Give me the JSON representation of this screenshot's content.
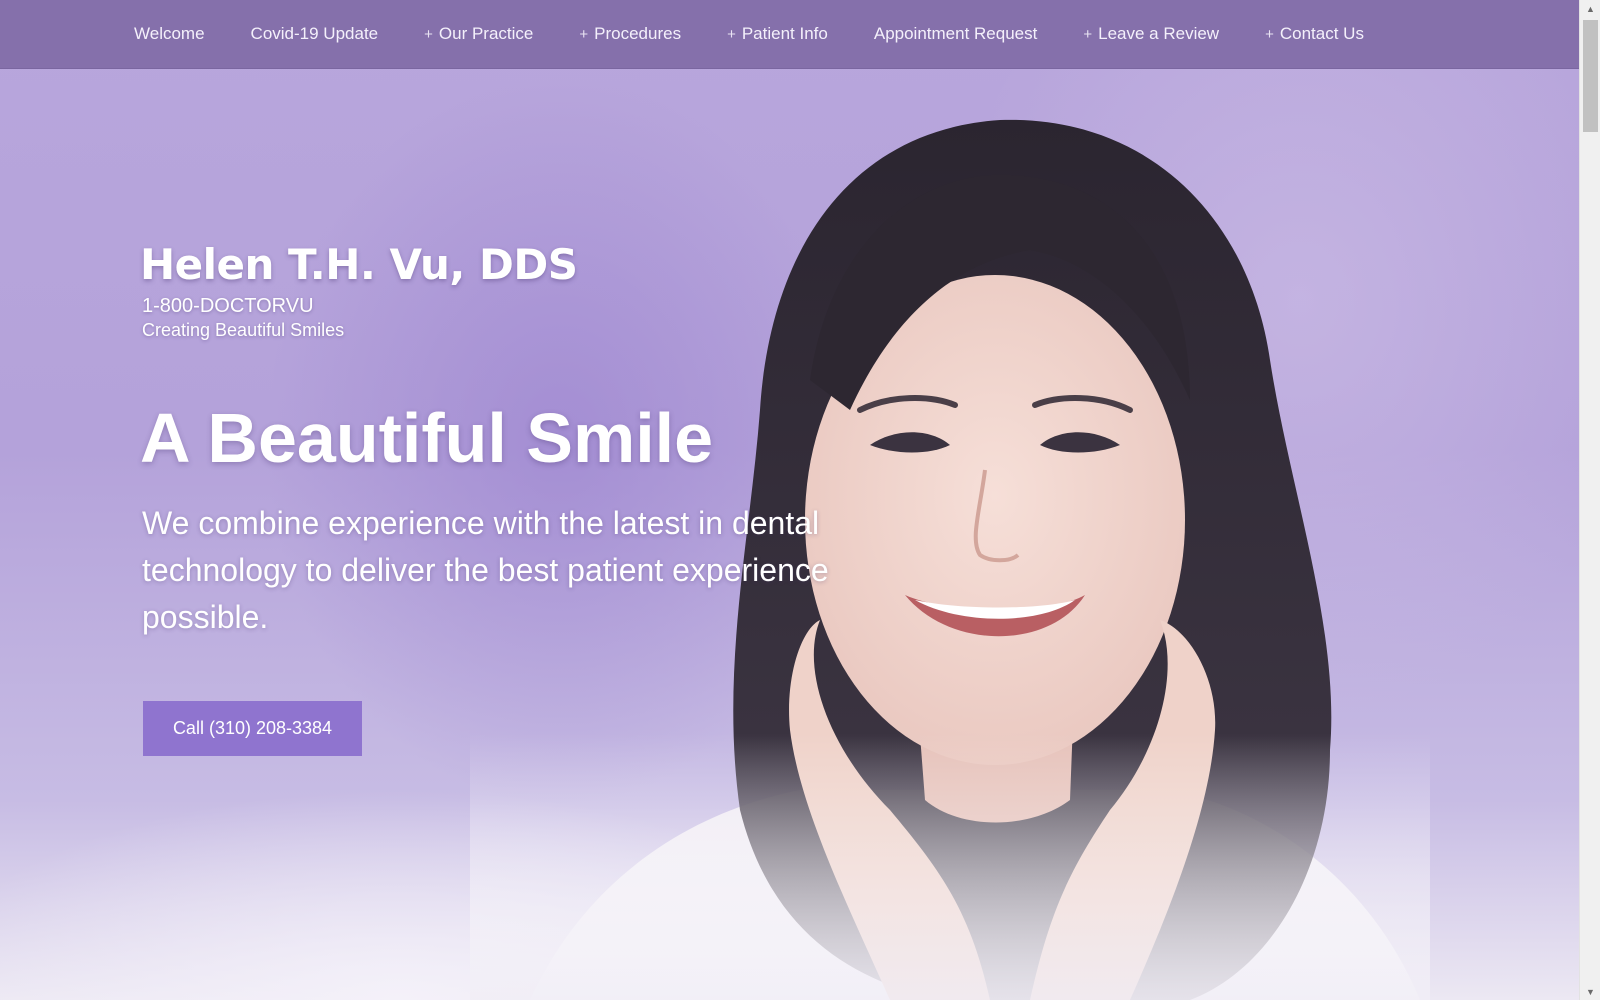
{
  "nav": {
    "items": [
      {
        "label": "Welcome",
        "has_submenu": false
      },
      {
        "label": "Covid-19 Update",
        "has_submenu": false
      },
      {
        "label": "Our Practice",
        "has_submenu": true
      },
      {
        "label": "Procedures",
        "has_submenu": true
      },
      {
        "label": "Patient Info",
        "has_submenu": true
      },
      {
        "label": "Appointment Request",
        "has_submenu": false
      },
      {
        "label": "Leave a Review",
        "has_submenu": true
      },
      {
        "label": "Contact Us",
        "has_submenu": true
      }
    ],
    "submenu_symbol": "+"
  },
  "brand": {
    "name": "Helen T.H. Vu, DDS",
    "phone": "1-800-DOCTORVU",
    "tagline": "Creating Beautiful Smiles"
  },
  "hero": {
    "title": "A Beautiful Smile",
    "text": "We combine experience with the latest in dental technology to deliver the best patient experience possible.",
    "cta_label": "Call (310) 208-3384",
    "image_icon": "smiling-woman-portrait"
  },
  "colors": {
    "nav_bg": "#8570ab",
    "hero_bg": "#b8a6dc",
    "button_bg": "#8f74cf",
    "text": "#ffffff"
  },
  "scrollbar": {
    "up_icon": "scroll-up-arrow-icon",
    "down_icon": "scroll-down-arrow-icon"
  }
}
